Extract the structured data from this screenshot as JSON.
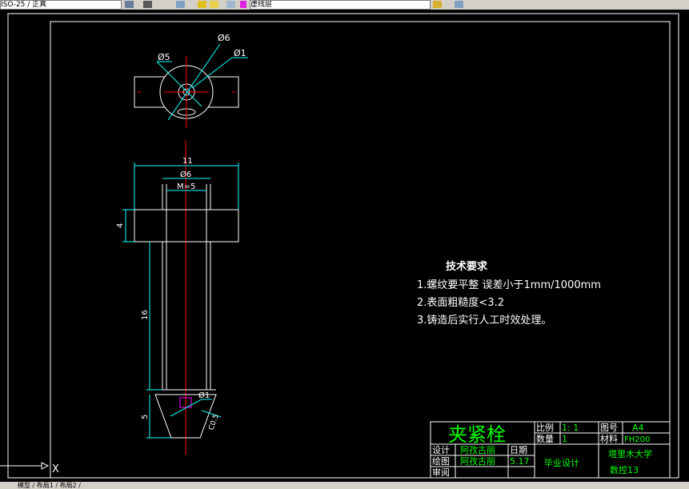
{
  "toolbar": {
    "left_dropdown": "ISO-25 / 正真",
    "layer_dropdown": "虚线层",
    "colors": {
      "bg": "#d4d0c8"
    }
  },
  "drawing": {
    "top_view": {
      "dim_phi5": "Ø5",
      "dim_phi6": "Ø6",
      "dim_phi1": "Ø1"
    },
    "front_view": {
      "dim_11": "11",
      "dim_phi6": "Ø6",
      "dim_m5": "M=5",
      "dim_4": "4",
      "dim_16": "16",
      "dim_5": "5",
      "dim_phi1": "Ø1",
      "dim_c5": "C0.5"
    },
    "tech_req": {
      "title": "技术要求",
      "items": [
        "1.螺纹要平整 误差小于1mm/1000mm",
        "2.表面粗糙度<3.2",
        "3.铸造后实行人工时效处理。"
      ]
    },
    "title_block": {
      "part_name": "夹紧栓",
      "scale_label": "比例",
      "scale_value": "1: 1",
      "drawing_no_label": "图号",
      "drawing_no_value": "A4",
      "qty_label": "数量",
      "qty_value": "1",
      "material_label": "材料",
      "material_value": "FH200",
      "design_label": "设计",
      "design_name": "阿孜古丽",
      "date_label": "日期",
      "draw_label": "绘图",
      "draw_name": "阿孜古丽",
      "draw_date": "5.17",
      "review_label": "审阅",
      "project": "毕业设计",
      "school": "塔里木大学",
      "class_name": "数控13"
    },
    "ucs": {
      "x_label": "X"
    }
  },
  "statusbar": {
    "tabs": "模型 / 布局1 / 布局2 /"
  },
  "colors": {
    "background": "#000000",
    "outline": "#ffffff",
    "dimension": "#00ffff",
    "centerline": "#ff0000",
    "title_block_text": "#00ff00",
    "hidden_magenta": "#ff00ff"
  }
}
